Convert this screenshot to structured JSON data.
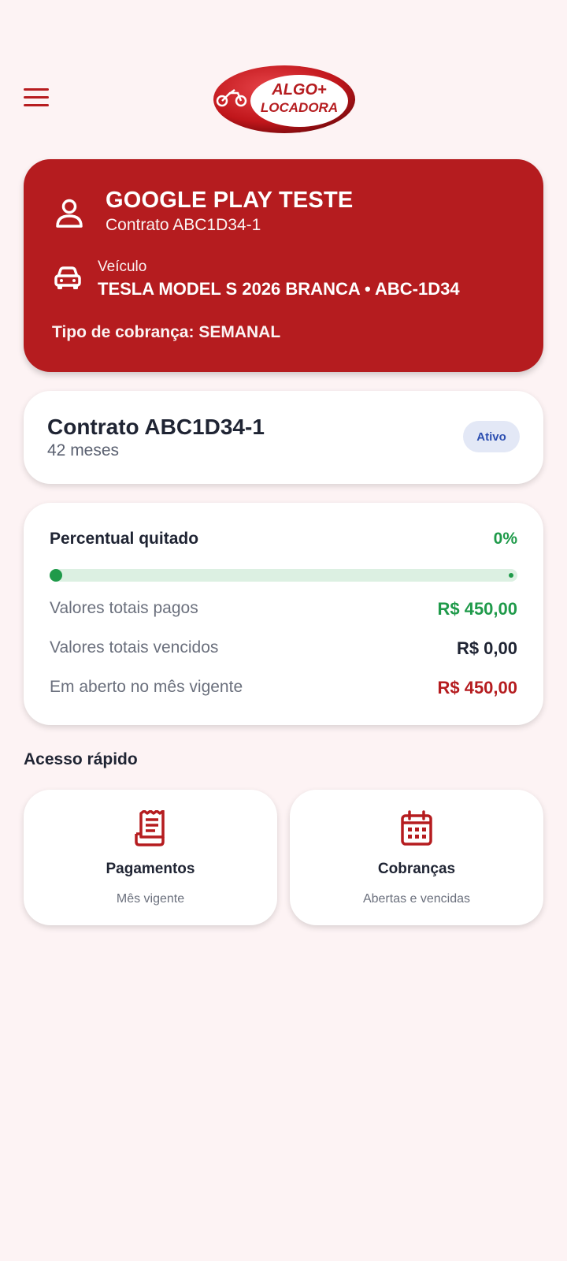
{
  "header": {
    "menu_icon": "hamburger-menu-icon",
    "logo": {
      "line1": "ALGO+",
      "line2": "LOCADORA",
      "icon": "motorcycle-icon"
    }
  },
  "client": {
    "name": "GOOGLE PLAY TESTE",
    "contract": "Contrato ABC1D34-1",
    "user_icon": "user-icon",
    "vehicle_icon": "car-icon",
    "vehicle_label": "Veículo",
    "vehicle_value": "TESLA MODEL S 2026 BRANCA • ABC-1D34",
    "billing_type": "Tipo de cobrança: SEMANAL"
  },
  "contract": {
    "title": "Contrato ABC1D34-1",
    "duration": "42 meses",
    "status": "Ativo"
  },
  "payment_summary": {
    "title": "Percentual quitado",
    "percent_label": "0%",
    "progress_fraction": 0,
    "rows": [
      {
        "label": "Valores totais pagos",
        "value": "R$ 450,00"
      },
      {
        "label": "Valores totais vencidos",
        "value": "R$ 0,00"
      },
      {
        "label": "Em aberto no mês vigente",
        "value": "R$ 450,00"
      }
    ]
  },
  "quick_access": {
    "heading": "Acesso rápido",
    "items": [
      {
        "title": "Pagamentos",
        "subtitle": "Mês vigente",
        "icon": "receipt-icon"
      },
      {
        "title": "Cobranças",
        "subtitle": "Abertas e vencidas",
        "icon": "calendar-icon"
      }
    ]
  },
  "colors": {
    "brand_red": "#b51c1f",
    "success_green": "#1f9a4a",
    "background": "#fdf3f4",
    "badge_blue": "#2d4fb1"
  }
}
